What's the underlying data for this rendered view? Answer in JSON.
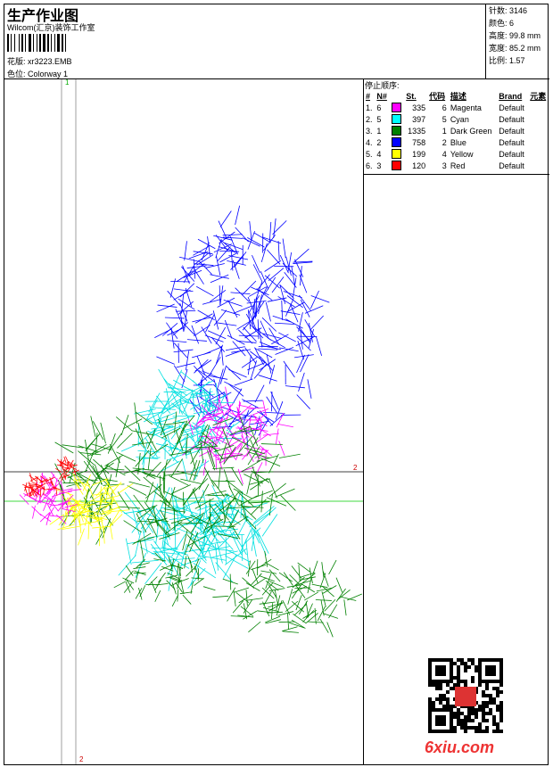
{
  "header": {
    "title": "生产作业图",
    "company": "Wilcom(汇京)装饰工作室",
    "design_label": "花版:",
    "design_value": "xr3223.EMB",
    "colorway_label": "色位:",
    "colorway_value": "Colorway 1"
  },
  "stats": {
    "stitches": "针数: 3146",
    "colors": "颜色: 6",
    "height": "高度: 99.8 mm",
    "width": "宽度: 85.2 mm",
    "scale": "比例: 1.57"
  },
  "sequence": {
    "title": "停止顺序:",
    "headers": [
      "#",
      "N#",
      "",
      "St.",
      "代码",
      "描述",
      "Brand",
      "元素"
    ],
    "rows": [
      {
        "idx": "1.",
        "n": "6",
        "color": "#ff00ff",
        "st": "335",
        "code": "6",
        "desc": "Magenta",
        "brand": "Default"
      },
      {
        "idx": "2.",
        "n": "5",
        "color": "#00ffff",
        "st": "397",
        "code": "5",
        "desc": "Cyan",
        "brand": "Default"
      },
      {
        "idx": "3.",
        "n": "1",
        "color": "#008000",
        "st": "1335",
        "code": "1",
        "desc": "Dark Green",
        "brand": "Default"
      },
      {
        "idx": "4.",
        "n": "2",
        "color": "#0000ff",
        "st": "758",
        "code": "2",
        "desc": "Blue",
        "brand": "Default"
      },
      {
        "idx": "5.",
        "n": "4",
        "color": "#ffff00",
        "st": "199",
        "code": "4",
        "desc": "Yellow",
        "brand": "Default"
      },
      {
        "idx": "6.",
        "n": "3",
        "color": "#ff0000",
        "st": "120",
        "code": "3",
        "desc": "Red",
        "brand": "Default"
      }
    ]
  },
  "guides": {
    "v1": "1",
    "h2": "2",
    "v2": "2"
  },
  "watermark": "6xiu.com"
}
